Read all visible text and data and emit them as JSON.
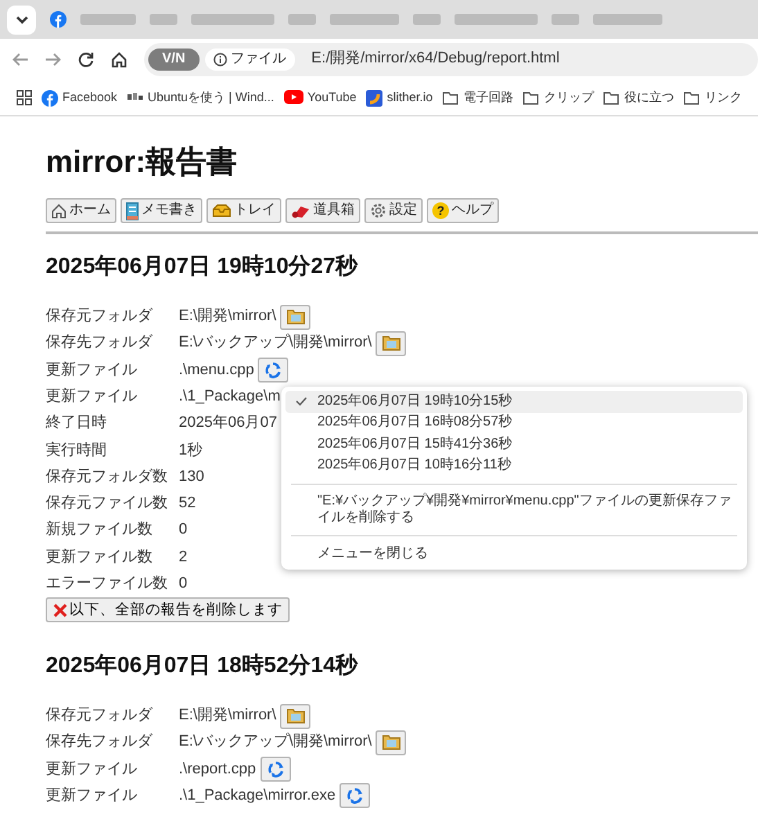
{
  "browser": {
    "address_bar": {
      "vpn_badge": "V/N",
      "site_chip": "ファイル",
      "url": "E:/開発/mirror/x64/Debug/report.html"
    },
    "bookmarks": [
      {
        "label": "Facebook",
        "kind": "facebook"
      },
      {
        "label": "Ubuntuを使う | Wind...",
        "kind": "ubuntu"
      },
      {
        "label": "YouTube",
        "kind": "youtube"
      },
      {
        "label": "slither.io",
        "kind": "slither"
      },
      {
        "label": "電子回路",
        "kind": "folder"
      },
      {
        "label": "クリップ",
        "kind": "folder"
      },
      {
        "label": "役に立つ",
        "kind": "folder"
      },
      {
        "label": "リンク",
        "kind": "folder"
      }
    ]
  },
  "page": {
    "title": "mirror:報告書",
    "toolbar": [
      {
        "label": "ホーム",
        "kind": "home"
      },
      {
        "label": "メモ書き",
        "kind": "memo"
      },
      {
        "label": "トレイ",
        "kind": "tray"
      },
      {
        "label": "道具箱",
        "kind": "toolbox"
      },
      {
        "label": "設定",
        "kind": "settings"
      },
      {
        "label": "ヘルプ",
        "kind": "help",
        "icon_char": "?"
      }
    ],
    "reports": [
      {
        "heading": "2025年06月07日 19時10分27秒",
        "rows": [
          {
            "label": "保存元フォルダ",
            "value": "E:\\開発\\mirror\\",
            "kind": "folder"
          },
          {
            "label": "保存先フォルダ",
            "value": "E:\\バックアップ\\開発\\mirror\\",
            "kind": "folder"
          },
          {
            "label": "更新ファイル",
            "value": ".\\menu.cpp",
            "kind": "restore"
          },
          {
            "label": "更新ファイル",
            "value": ".\\1_Package\\m"
          },
          {
            "label": "終了日時",
            "value": "2025年06月07"
          },
          {
            "label": "実行時間",
            "value": "1秒"
          },
          {
            "label": "保存元フォルダ数",
            "value": "130"
          },
          {
            "label": "保存元ファイル数",
            "value": "52"
          },
          {
            "label": "新規ファイル数",
            "value": "0"
          },
          {
            "label": "更新ファイル数",
            "value": "2"
          },
          {
            "label": "エラーファイル数",
            "value": "0"
          }
        ],
        "delete_button": "以下、全部の報告を削除します"
      },
      {
        "heading": "2025年06月07日 18時52分14秒",
        "rows": [
          {
            "label": "保存元フォルダ",
            "value": "E:\\開発\\mirror\\",
            "kind": "folder"
          },
          {
            "label": "保存先フォルダ",
            "value": "E:\\バックアップ\\開発\\mirror\\",
            "kind": "folder"
          },
          {
            "label": "更新ファイル",
            "value": ".\\report.cpp",
            "kind": "restore"
          },
          {
            "label": "更新ファイル",
            "value": ".\\1_Package\\mirror.exe",
            "kind": "restore"
          }
        ]
      }
    ]
  },
  "context_menu": {
    "items": [
      {
        "kind": "option",
        "label": "2025年06月07日 19時10分15秒",
        "selected": true
      },
      {
        "kind": "option",
        "label": "2025年06月07日 16時08分57秒",
        "selected": false
      },
      {
        "kind": "option",
        "label": "2025年06月07日 15時41分36秒",
        "selected": false
      },
      {
        "kind": "option",
        "label": "2025年06月07日 10時16分11秒",
        "selected": false
      },
      {
        "kind": "separator"
      },
      {
        "kind": "action",
        "label": "\"E:¥バックアップ¥開発¥mirror¥menu.cpp\"ファイルの更新保存ファイルを削除する"
      },
      {
        "kind": "separator"
      },
      {
        "kind": "action",
        "label": "メニューを閉じる"
      }
    ]
  }
}
